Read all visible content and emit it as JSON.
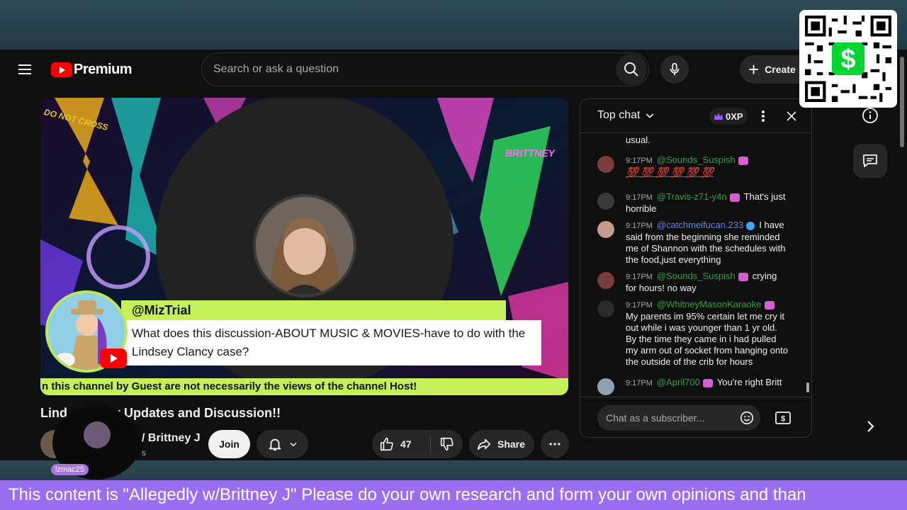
{
  "masthead": {
    "logo_text": "Premium",
    "search_placeholder": "Search or ask a question",
    "create_label": "Create"
  },
  "video": {
    "question_author": "@MizTrial",
    "question_text": "What does this discussion-ABOUT MUSIC & MOVIES-have to do with the Lindsey Clancy case?",
    "ticker_text": "n this channel by Guest are not necessarily the views of the channel Host!",
    "overlay_brand": "BRITTNEY",
    "overlay_tape": "DO NOT CROSS"
  },
  "below_video": {
    "title_start": "Lind",
    "title_end": "cy Updates and Discussion!!",
    "channel_name": "/ Brittney J",
    "subs": "s",
    "join_label": "Join",
    "like_count": "47",
    "share_label": "Share"
  },
  "chat": {
    "header_label": "Top chat",
    "xp_label": "0XP",
    "input_placeholder": "Chat as a subscriber...",
    "messages": [
      {
        "time": "",
        "author": "",
        "text": "usual."
      },
      {
        "time": "9:17PM",
        "author": "@Sounds_Suspish",
        "text": "",
        "emoji": "💯 💯 💯 💯 💯 💯"
      },
      {
        "time": "9:17PM",
        "author": "@Travis-z71-y4n",
        "text": "That's just horrible"
      },
      {
        "time": "9:17PM",
        "author": "@catchmeifucan.233",
        "text": "I have said from the beginning she reminded me of Shannon with the schedules with the food,just everything"
      },
      {
        "time": "9:17PM",
        "author": "@Sounds_Suspish",
        "text": "crying for hours! no way"
      },
      {
        "time": "9:17PM",
        "author": "@WhitneyMasonKaraoke",
        "text": "My parents im 95% certain let me cry it out while i was younger than 1 yr old. By the time they came in i had pulled my arm out of socket from hanging onto the outside of the crib for hours"
      },
      {
        "time": "9:17PM",
        "author": "@April700",
        "text": "You're right Britt"
      }
    ]
  },
  "viewer_badge": {
    "name": "lzmac25"
  },
  "marquee_text": "This content is \"Allegedly w/Brittney J\" Please do your own research and form your own opinions and than",
  "colors": {
    "accent_green": "#c5f05a",
    "youtube_red": "#ff0000",
    "marquee_purple": "#9b6df0",
    "chat_name_green": "#2ba640"
  },
  "icons": [
    "menu-icon",
    "search-icon",
    "mic-icon",
    "plus-icon",
    "chevron-down-icon",
    "crown-icon",
    "kebab-icon",
    "close-icon",
    "emoji-icon",
    "super-chat-icon",
    "info-icon",
    "comments-icon",
    "chevron-right-icon",
    "bell-icon",
    "like-icon",
    "dislike-icon",
    "share-icon",
    "more-icon",
    "qr-code-icon",
    "cash-app-icon"
  ]
}
